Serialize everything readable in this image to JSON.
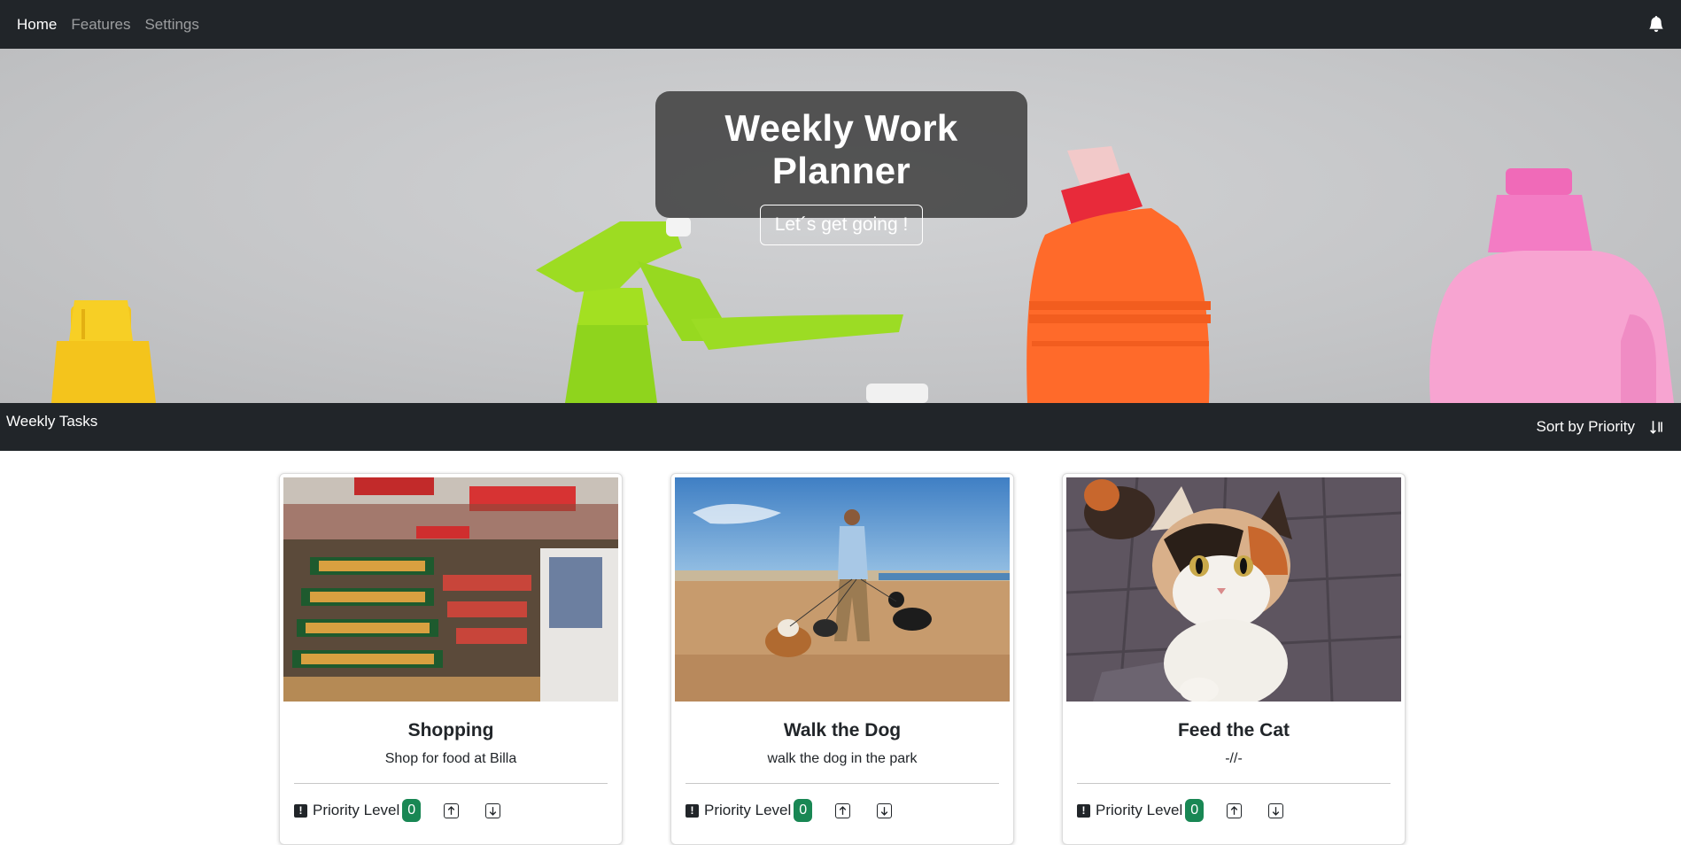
{
  "nav": {
    "items": [
      {
        "label": "Home",
        "active": true
      },
      {
        "label": "Features",
        "active": false
      },
      {
        "label": "Settings",
        "active": false
      }
    ],
    "bell_icon": "bell-icon"
  },
  "hero": {
    "title": "Weekly Work Planner",
    "button_label": "Let´s get going !"
  },
  "tasks_bar": {
    "title": "Weekly Tasks",
    "sort_label": "Sort by Priority",
    "sort_icon": "sort-down-icon"
  },
  "cards": [
    {
      "title": "Shopping",
      "text": "Shop for food at Billa",
      "priority_label": "Priority Level",
      "priority_value": "0",
      "image": "supermarket produce aisle"
    },
    {
      "title": "Walk the Dog",
      "text": "walk the dog in the park",
      "priority_label": "Priority Level",
      "priority_value": "0",
      "image": "man walking dogs on beach"
    },
    {
      "title": "Feed the Cat",
      "text": "-//-",
      "priority_label": "Priority Level",
      "priority_value": "0",
      "image": "calico cat on paving"
    }
  ],
  "colors": {
    "navbar": "#212529",
    "badge": "#198754",
    "hero_box": "#484848"
  }
}
